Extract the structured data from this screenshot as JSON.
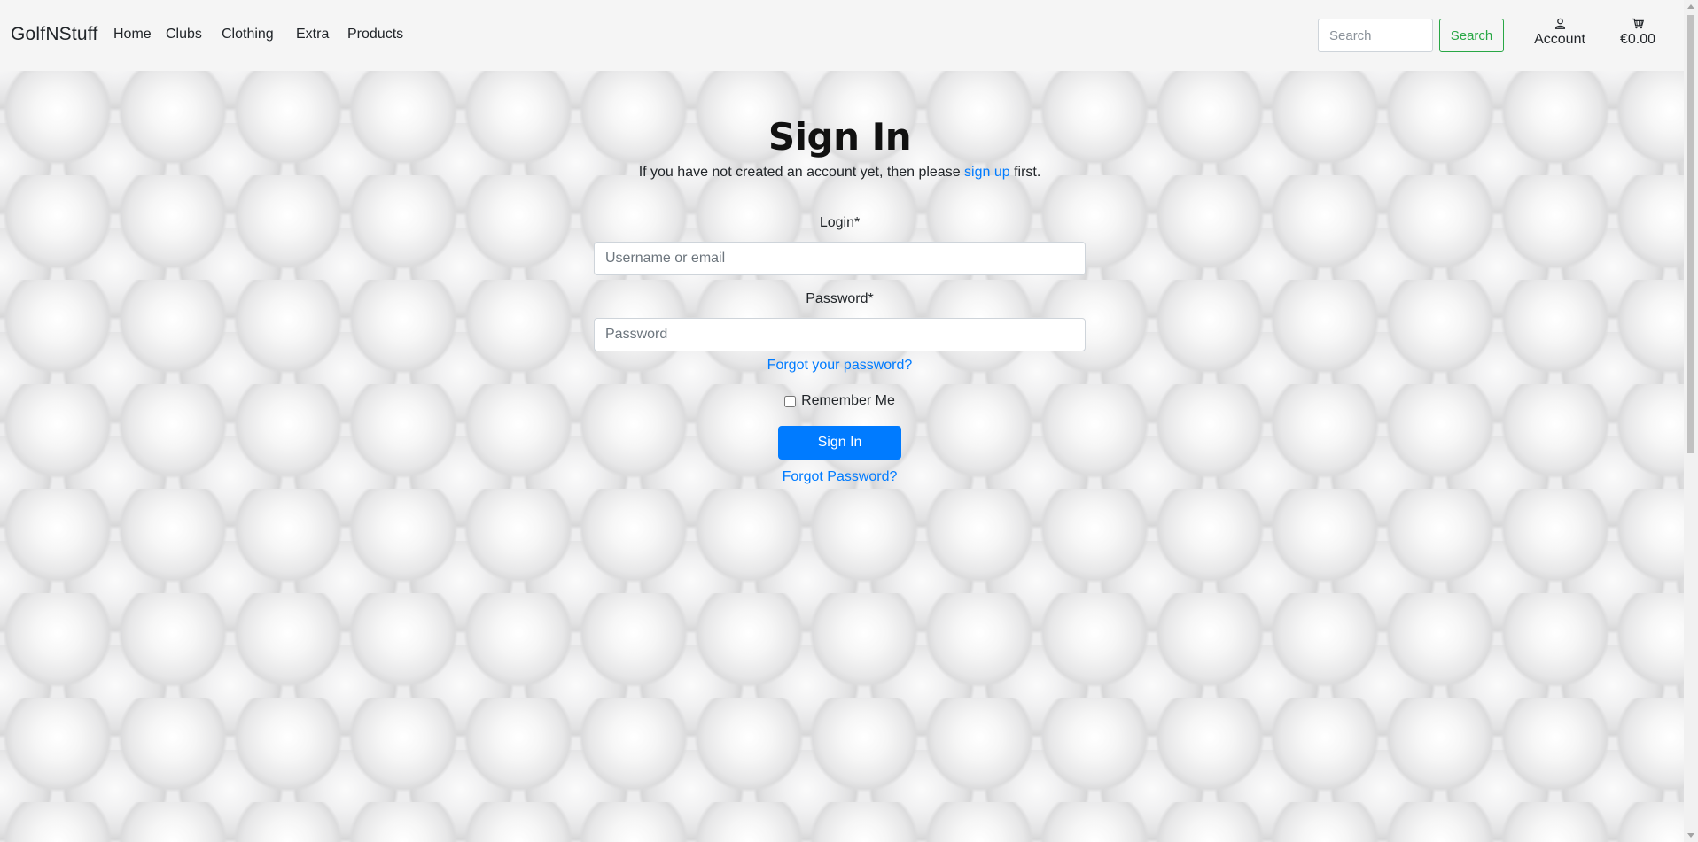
{
  "navbar": {
    "brand": "GolfNStuff",
    "links": [
      "Home",
      "Clubs",
      "Clothing",
      "Extra",
      "Products"
    ],
    "search_placeholder": "Search",
    "search_button": "Search",
    "account_label": "Account",
    "account_icon": "user-icon",
    "cart_total": "€0.00",
    "cart_icon": "cart-icon"
  },
  "signin": {
    "title": "Sign In",
    "intro_before": "If you have not created an account yet, then please ",
    "intro_link": "sign up",
    "intro_after": " first.",
    "login_label": "Login*",
    "login_placeholder": "Username or email",
    "password_label": "Password*",
    "password_placeholder": "Password",
    "forgot_link_1": "Forgot your password?",
    "remember_label": "Remember Me",
    "submit_label": "Sign In",
    "forgot_link_2": "Forgot Password?"
  },
  "colors": {
    "primary": "#007bff",
    "success": "#28a745",
    "navbar_bg": "#f5f5f5"
  }
}
